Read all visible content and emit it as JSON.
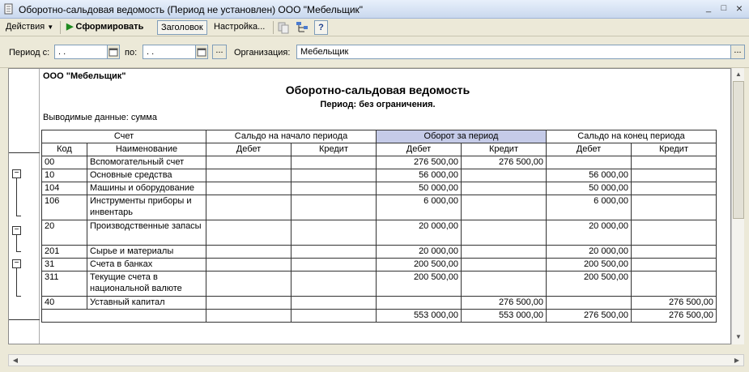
{
  "window": {
    "title": "Оборотно-сальдовая ведомость (Период не установлен) ООО \"Мебельщик\"",
    "minimize": "_",
    "maximize": "□",
    "close": "×"
  },
  "toolbar": {
    "actions_label": "Действия",
    "generate_label": "Сформировать",
    "header_label": "Заголовок",
    "settings_label": "Настройка...",
    "help_label": "?"
  },
  "filters": {
    "period_from_label": "Период с:",
    "period_from_value": " .  .",
    "period_to_label": "по:",
    "period_to_value": " .  .",
    "dots_label": "...",
    "org_label": "Организация:",
    "org_value": "Мебельщик"
  },
  "report": {
    "org_name": "ООО \"Мебельщик\"",
    "title": "Оборотно-сальдовая ведомость",
    "period": "Период: без ограничения.",
    "output": "Выводимые данные: сумма",
    "headers": {
      "account": "Счет",
      "opening": "Сальдо на начало периода",
      "turnover": "Оборот за период",
      "closing": "Сальдо на конец периода",
      "code": "Код",
      "name": "Наименование",
      "debit": "Дебет",
      "credit": "Кредит"
    },
    "rows": [
      {
        "code": "00",
        "name": "Вспомогательный счет",
        "od": "",
        "oc": "",
        "td": "276 500,00",
        "tc": "276 500,00",
        "cd": "",
        "cc": ""
      },
      {
        "code": "10",
        "name": "Основные средства",
        "od": "",
        "oc": "",
        "td": "56 000,00",
        "tc": "",
        "cd": "56 000,00",
        "cc": ""
      },
      {
        "code": "104",
        "name": "Машины и оборудование",
        "od": "",
        "oc": "",
        "td": "50 000,00",
        "tc": "",
        "cd": "50 000,00",
        "cc": ""
      },
      {
        "code": "106",
        "name": "Инструменты приборы и инвентарь",
        "od": "",
        "oc": "",
        "td": "6 000,00",
        "tc": "",
        "cd": "6 000,00",
        "cc": ""
      },
      {
        "code": "20",
        "name": "Производственные запасы",
        "od": "",
        "oc": "",
        "td": "20 000,00",
        "tc": "",
        "cd": "20 000,00",
        "cc": ""
      },
      {
        "code": "201",
        "name": "Сырье и материалы",
        "od": "",
        "oc": "",
        "td": "20 000,00",
        "tc": "",
        "cd": "20 000,00",
        "cc": ""
      },
      {
        "code": "31",
        "name": "Счета в банках",
        "od": "",
        "oc": "",
        "td": "200 500,00",
        "tc": "",
        "cd": "200 500,00",
        "cc": ""
      },
      {
        "code": "311",
        "name": "Текущие счета в национальной валюте",
        "od": "",
        "oc": "",
        "td": "200 500,00",
        "tc": "",
        "cd": "200 500,00",
        "cc": ""
      },
      {
        "code": "40",
        "name": "Уставный капитал",
        "od": "",
        "oc": "",
        "td": "",
        "tc": "276 500,00",
        "cd": "",
        "cc": "276 500,00"
      }
    ],
    "totals": {
      "od": "",
      "oc": "",
      "td": "553 000,00",
      "tc": "553 000,00",
      "cd": "276 500,00",
      "cc": "276 500,00"
    }
  }
}
